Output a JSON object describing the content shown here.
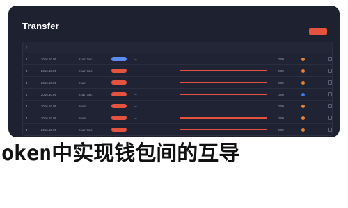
{
  "panel": {
    "title": "Transfer"
  },
  "colors": {
    "accent": "#e4533d",
    "pill_blue": "#5b8def",
    "status_orange": "#e8833a",
    "status_blue": "#3d7be4"
  },
  "table": {
    "headers": [
      "#",
      "",
      "",
      "",
      "",
      "",
      "",
      "",
      ""
    ],
    "rows": [
      {
        "no": "2",
        "hash": "2016.10.05",
        "from": "Xcuin Sec",
        "type": "blue",
        "date": "—",
        "id": "",
        "to_bar": "none",
        "amount": "0.00",
        "status": "",
        "status_color": "orange"
      },
      {
        "no": "4",
        "hash": "2016.10.05",
        "from": "Xcuin Sec",
        "type": "red",
        "date": "—",
        "id": "",
        "to_bar": "red",
        "amount": "0.00",
        "status": "",
        "status_color": "orange"
      },
      {
        "no": "4",
        "hash": "2016.10.05",
        "from": "Xcuin",
        "type": "red",
        "date": "—",
        "id": "",
        "to_bar": "red",
        "amount": "0.00",
        "status": "",
        "status_color": "orange"
      },
      {
        "no": "4",
        "hash": "2016.10.05",
        "from": "Xcuin Sec",
        "type": "red",
        "date": "—",
        "id": "",
        "to_bar": "red",
        "amount": "0.00",
        "status": "",
        "status_color": "blue"
      },
      {
        "no": "4",
        "hash": "2016.10.05",
        "from": "Yaxis",
        "type": "red",
        "date": "—",
        "id": "",
        "to_bar": "none",
        "amount": "0.00",
        "status": "",
        "status_color": "orange"
      },
      {
        "no": "4",
        "hash": "2016.10.05",
        "from": "Yaxis",
        "type": "red",
        "date": "—",
        "id": "",
        "to_bar": "red",
        "amount": "0.00",
        "status": "",
        "status_color": "orange"
      },
      {
        "no": "4",
        "hash": "2016.10.05",
        "from": "Xcuin Sec",
        "type": "red",
        "date": "—",
        "id": "",
        "to_bar": "red",
        "amount": "0.00",
        "status": "",
        "status_color": "orange"
      }
    ]
  },
  "caption": "oken中实现钱包间的互导"
}
